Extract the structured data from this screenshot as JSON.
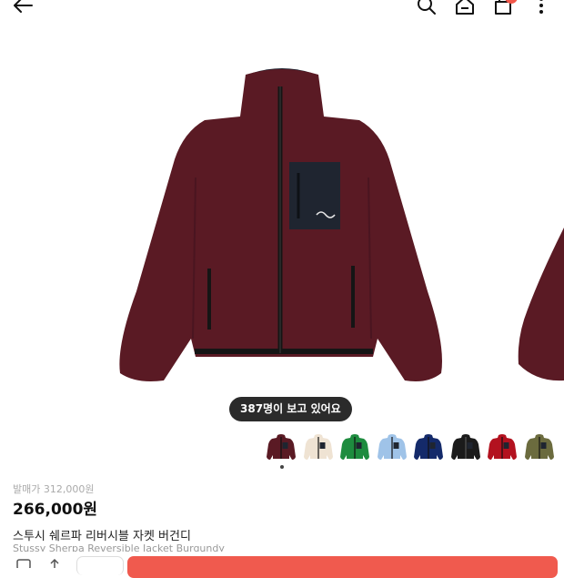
{
  "header": {
    "back_icon": "arrow-left-icon",
    "search_icon": "search-icon",
    "home_icon": "home-icon",
    "cart_icon": "shopping-bag-icon",
    "more_icon": "more-vertical-icon",
    "cart_badge": "0"
  },
  "gallery": {
    "viewers_text": "387명이 보고 있어요",
    "active_index": 0,
    "jacket_color": "#5a1a24",
    "thumbnail_colors": [
      "#5a1a24",
      "#efe3d3",
      "#1e8c3f",
      "#9fc3e8",
      "#142a6a",
      "#1b1b1b",
      "#b3121f",
      "#6b6b3e"
    ]
  },
  "product": {
    "original_price": "발매가 312,000원",
    "sale_price": "266,000원",
    "name_ko": "스투시 쉐르파 리버시블 자켓 버건디",
    "name_en": "Stussy Sherpa Reversible Jacket Burgundy"
  },
  "bottom": {
    "cta_color": "#f05a4e"
  }
}
